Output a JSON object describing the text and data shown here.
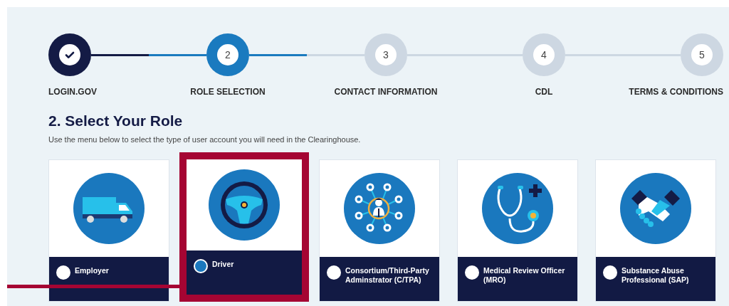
{
  "steps": [
    {
      "label": "LOGIN.GOV",
      "completed": true,
      "current": false
    },
    {
      "label": "ROLE SELECTION",
      "number": "2",
      "completed": false,
      "current": true
    },
    {
      "label": "CONTACT INFORMATION",
      "number": "3",
      "completed": false,
      "current": false
    },
    {
      "label": "CDL",
      "number": "4",
      "completed": false,
      "current": false
    },
    {
      "label": "TERMS & CONDITIONS",
      "number": "5",
      "completed": false,
      "current": false
    }
  ],
  "heading": "2. Select Your Role",
  "instructions": "Use the menu below to select the type of user account you will need in the Clearinghouse.",
  "roles": [
    {
      "label": "Employer",
      "selected": false,
      "highlighted": false
    },
    {
      "label": "Driver",
      "selected": true,
      "highlighted": true
    },
    {
      "label": "Consortium/Third-Party Adminstrator (C/TPA)",
      "selected": false,
      "highlighted": false
    },
    {
      "label": "Medical Review Officer (MRO)",
      "selected": false,
      "highlighted": false
    },
    {
      "label": "Substance Abuse Professional (SAP)",
      "selected": false,
      "highlighted": false
    }
  ]
}
